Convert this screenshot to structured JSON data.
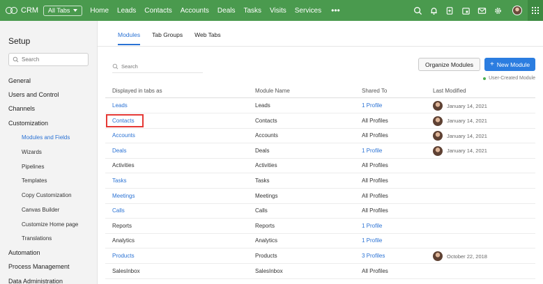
{
  "app": {
    "name": "CRM",
    "all_tabs_label": "All Tabs",
    "nav": [
      "Home",
      "Leads",
      "Contacts",
      "Accounts",
      "Deals",
      "Tasks",
      "Visits",
      "Services"
    ],
    "more_label": "•••",
    "brand_color": "#4a9a4e"
  },
  "sidebar": {
    "title": "Setup",
    "search_placeholder": "Search",
    "items": [
      {
        "label": "General"
      },
      {
        "label": "Users and Control"
      },
      {
        "label": "Channels"
      },
      {
        "label": "Customization"
      }
    ],
    "subitems": [
      {
        "label": "Modules and Fields",
        "active": true
      },
      {
        "label": "Wizards"
      },
      {
        "label": "Pipelines"
      },
      {
        "label": "Templates"
      },
      {
        "label": "Copy Customization"
      },
      {
        "label": "Canvas Builder"
      },
      {
        "label": "Customize Home page"
      },
      {
        "label": "Translations"
      }
    ],
    "bottom_items": [
      {
        "label": "Automation"
      },
      {
        "label": "Process Management"
      },
      {
        "label": "Data Administration"
      }
    ]
  },
  "tabs": [
    "Modules",
    "Tab Groups",
    "Web Tabs"
  ],
  "search_placeholder": "Search",
  "buttons": {
    "organize": "Organize Modules",
    "new_module": "New Module"
  },
  "legend": "User-Created Module",
  "table": {
    "headers": [
      "Displayed in tabs as",
      "Module Name",
      "Shared To",
      "Last Modified"
    ],
    "rows": [
      {
        "display": "Leads",
        "module": "Leads",
        "shared": "1 Profile",
        "modified": "January 14, 2021",
        "display_link": true,
        "shared_link": true
      },
      {
        "display": "Contacts",
        "module": "Contacts",
        "shared": "All Profiles",
        "modified": "January 14, 2021",
        "display_link": true,
        "shared_link": false
      },
      {
        "display": "Accounts",
        "module": "Accounts",
        "shared": "All Profiles",
        "modified": "January 14, 2021",
        "display_link": true,
        "shared_link": false
      },
      {
        "display": "Deals",
        "module": "Deals",
        "shared": "1 Profile",
        "modified": "January 14, 2021",
        "display_link": true,
        "shared_link": true
      },
      {
        "display": "Activities",
        "module": "Activities",
        "shared": "All Profiles",
        "modified": "",
        "display_link": false,
        "shared_link": false
      },
      {
        "display": "Tasks",
        "module": "Tasks",
        "shared": "All Profiles",
        "modified": "",
        "display_link": true,
        "shared_link": false
      },
      {
        "display": "Meetings",
        "module": "Meetings",
        "shared": "All Profiles",
        "modified": "",
        "display_link": true,
        "shared_link": false
      },
      {
        "display": "Calls",
        "module": "Calls",
        "shared": "All Profiles",
        "modified": "",
        "display_link": true,
        "shared_link": false
      },
      {
        "display": "Reports",
        "module": "Reports",
        "shared": "1 Profile",
        "modified": "",
        "display_link": false,
        "shared_link": true
      },
      {
        "display": "Analytics",
        "module": "Analytics",
        "shared": "1 Profile",
        "modified": "",
        "display_link": false,
        "shared_link": true
      },
      {
        "display": "Products",
        "module": "Products",
        "shared": "3 Profiles",
        "modified": "October 22, 2018",
        "display_link": true,
        "shared_link": true
      },
      {
        "display": "SalesInbox",
        "module": "SalesInbox",
        "shared": "All Profiles",
        "modified": "",
        "display_link": false,
        "shared_link": false
      }
    ]
  }
}
